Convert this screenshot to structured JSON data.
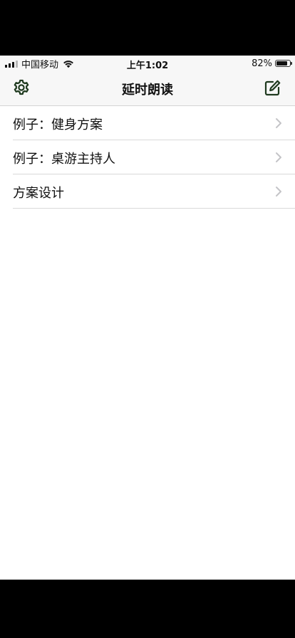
{
  "status_bar": {
    "carrier": "中国移动",
    "time": "上午1:02",
    "battery_percent": "82%",
    "battery_level": 0.82
  },
  "nav": {
    "title": "延时朗读",
    "settings_icon": "gear-icon",
    "compose_icon": "compose-icon"
  },
  "list": {
    "items": [
      {
        "label": "例子：健身方案"
      },
      {
        "label": "例子：桌游主持人"
      },
      {
        "label": "方案设计"
      }
    ]
  },
  "colors": {
    "accent": "#1f3a1f",
    "bar_background": "#f7f7f7",
    "separator": "#d9d9d9",
    "chevron": "#c4c4c7"
  }
}
